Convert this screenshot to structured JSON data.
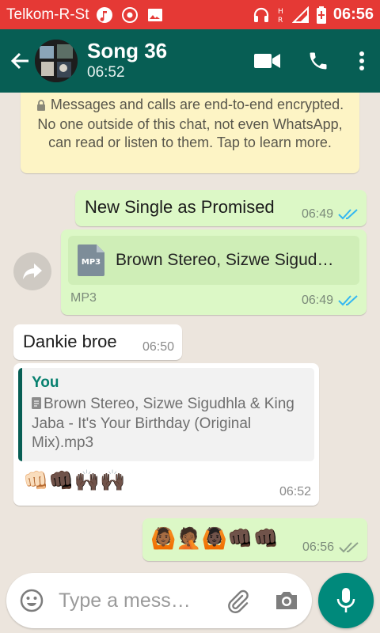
{
  "status": {
    "carrier": "Telkom-R-St",
    "time": "06:56"
  },
  "header": {
    "title": "Song 36",
    "subtitle": "06:52"
  },
  "encryption_notice": "Messages and calls are end-to-end encrypted. No one outside of this chat, not even WhatsApp, can read or listen to them. Tap to learn more.",
  "messages": [
    {
      "text": "New Single as Promised",
      "time": "06:49"
    },
    {
      "doc_name": "Brown Stereo, Sizwe Sigud…",
      "doc_icon_label": "MP3",
      "doc_type": "MP3",
      "time": "06:49"
    },
    {
      "text": "Dankie broe",
      "time": "06:50"
    },
    {
      "quote_author": "You",
      "quote_text": "Brown Stereo, Sizwe Sigudhla & King Jaba - It's Your Birthday (Original Mix).mp3",
      "emoji": "👊🏻👊🏿🙌🏿🙌🏿",
      "time": "06:52"
    },
    {
      "emoji": "🙆🏾🤦🏾🙆🏿👊🏿👊🏿",
      "time": "06:56"
    }
  ],
  "composer": {
    "placeholder": "Type a mess…"
  },
  "colors": {
    "statusbar": "#e53935",
    "appbar": "#075e54",
    "outgoing": "#dcf8c6",
    "incoming": "#ffffff",
    "read_tick": "#34b7f1",
    "send_button": "#00897b"
  }
}
